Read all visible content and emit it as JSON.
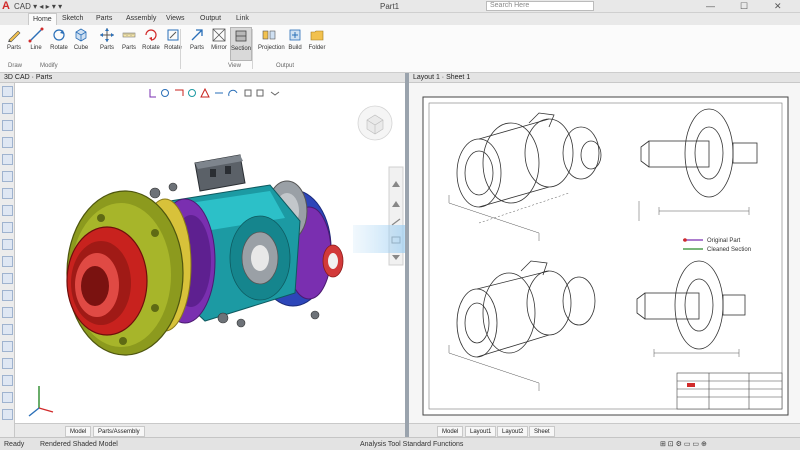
{
  "titlebar": {
    "logo": "A",
    "quick_access": "CAD ▾ ◂ ▸ ▾ ▾",
    "app_title": "Part1",
    "search_placeholder": "Search Here",
    "minimize": "—",
    "maximize": "☐",
    "close": "✕"
  },
  "tabs": [
    "Home",
    "Sketch",
    "Parts",
    "Assembly",
    "Views",
    "Output",
    "Link"
  ],
  "ribbon": {
    "tools": [
      {
        "label": "Parts",
        "icon": "pencil-icon"
      },
      {
        "label": "Line",
        "icon": "line-icon"
      },
      {
        "label": "Rotate",
        "icon": "rotate-icon"
      },
      {
        "label": "Cube",
        "icon": "cube-icon"
      },
      {
        "label": "Parts",
        "icon": "move-icon"
      },
      {
        "label": "Parts",
        "icon": "measure-icon"
      },
      {
        "label": "Rotate",
        "icon": "rotate-icon"
      },
      {
        "label": "Rotate",
        "icon": "rotate-icon"
      },
      {
        "label": "Parts",
        "icon": "arrow-icon"
      },
      {
        "label": "Mirror",
        "icon": "mirror-icon"
      },
      {
        "label": "Section",
        "icon": "section-icon"
      },
      {
        "label": "Projection",
        "icon": "projection-icon"
      },
      {
        "label": "Build",
        "icon": "build-icon"
      },
      {
        "label": "Folder",
        "icon": "folder-icon"
      }
    ],
    "groups": [
      "Draw",
      "Modify",
      "View",
      "Output"
    ]
  },
  "left_view": {
    "header": "3D CAD · Parts",
    "tabs": [
      "Model",
      "Parts/Assembly"
    ]
  },
  "right_view": {
    "header": "Layout 1 · Sheet 1",
    "legend": [
      "Original Part",
      "Cleaned Section"
    ],
    "tabs": [
      "Model",
      "Layout1",
      "Layout2",
      "Sheet"
    ]
  },
  "statusbar": {
    "left": "Ready",
    "coords": "Rendered Shaded Model",
    "mid": "Analysis Tool Standard Functions"
  },
  "colors": {
    "accent_blue": "#2a6fb8",
    "gear_teal": "#1c9aa3",
    "gear_purple": "#7a2fb0",
    "flange_olive": "#8c9a1e",
    "hub_red": "#c8221e",
    "gear_blue": "#2d46b9"
  }
}
